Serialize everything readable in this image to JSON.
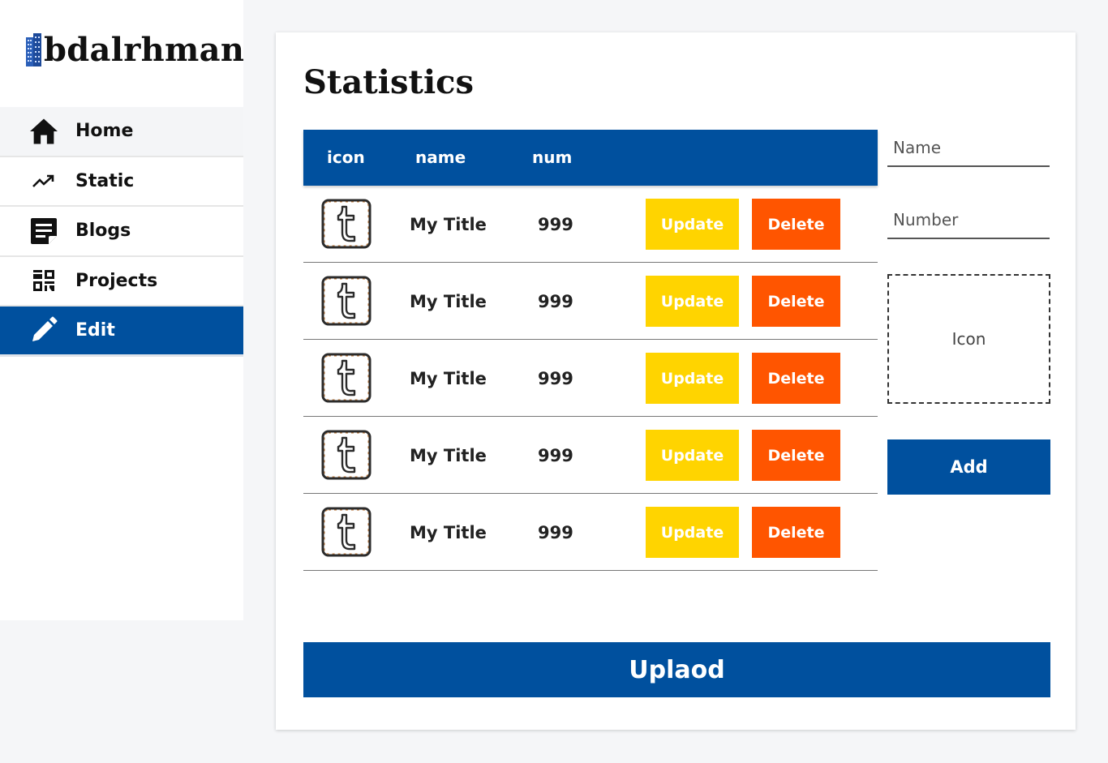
{
  "brand": {
    "logo_text": "bdalrhman"
  },
  "nav": [
    {
      "label": "Home",
      "icon": "home-icon"
    },
    {
      "label": "Static",
      "icon": "trending-up-icon"
    },
    {
      "label": "Blogs",
      "icon": "note-icon"
    },
    {
      "label": "Projects",
      "icon": "dashboard-icon"
    },
    {
      "label": "Edit",
      "icon": "pencil-icon"
    }
  ],
  "main": {
    "title": "Statistics"
  },
  "table": {
    "headers": [
      "icon",
      "name",
      "num"
    ],
    "rows": [
      {
        "icon": "tumblr-icon",
        "name": "My Title",
        "num": "999",
        "update_label": "Update",
        "delete_label": "Delete"
      },
      {
        "icon": "tumblr-icon",
        "name": "My Title",
        "num": "999",
        "update_label": "Update",
        "delete_label": "Delete"
      },
      {
        "icon": "tumblr-icon",
        "name": "My Title",
        "num": "999",
        "update_label": "Update",
        "delete_label": "Delete"
      },
      {
        "icon": "tumblr-icon",
        "name": "My Title",
        "num": "999",
        "update_label": "Update",
        "delete_label": "Delete"
      },
      {
        "icon": "tumblr-icon",
        "name": "My Title",
        "num": "999",
        "update_label": "Update",
        "delete_label": "Delete"
      }
    ]
  },
  "form": {
    "name_placeholder": "Name",
    "number_placeholder": "Number",
    "icon_label": "Icon",
    "add_label": "Add"
  },
  "upload_label": "Uplaod",
  "colors": {
    "primary": "#00509e",
    "update": "#ffd400",
    "delete": "#ff5500"
  }
}
